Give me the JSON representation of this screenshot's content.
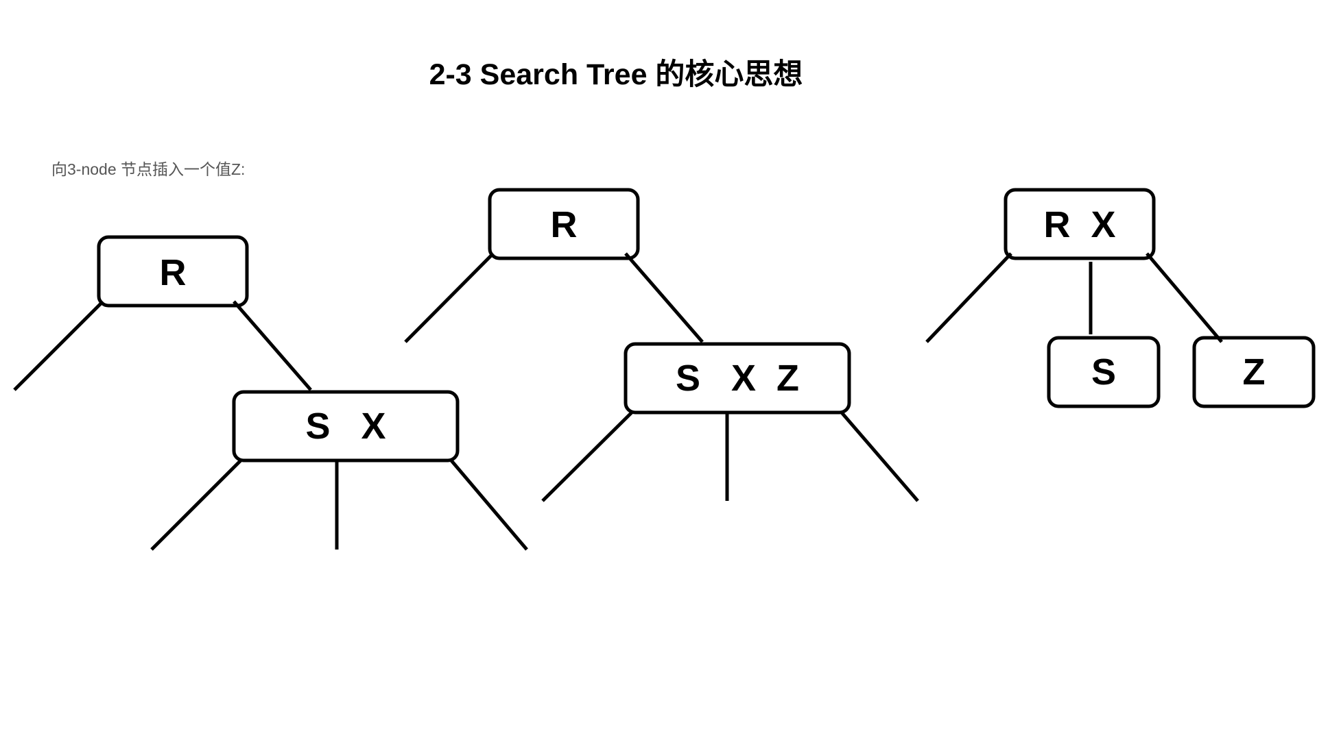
{
  "page": {
    "title": "2-3 Search Tree 的核心思想",
    "subtitle": "向3-node 节点插入一个值Z:"
  },
  "diagrams": [
    {
      "name": "step-1",
      "nodes": [
        {
          "id": "step1-root",
          "label": "R"
        },
        {
          "id": "step1-child",
          "label": "S   X"
        }
      ]
    },
    {
      "name": "step-2",
      "nodes": [
        {
          "id": "step2-root",
          "label": "R"
        },
        {
          "id": "step2-child",
          "label": "S   X  Z"
        }
      ]
    },
    {
      "name": "step-3",
      "nodes": [
        {
          "id": "step3-root",
          "label": "R  X"
        },
        {
          "id": "step3-left",
          "label": "S"
        },
        {
          "id": "step3-right",
          "label": "Z"
        }
      ]
    }
  ],
  "colors": {
    "stroke": "#000000",
    "text": "#000000",
    "subtitle": "#555555",
    "background": "#ffffff"
  }
}
